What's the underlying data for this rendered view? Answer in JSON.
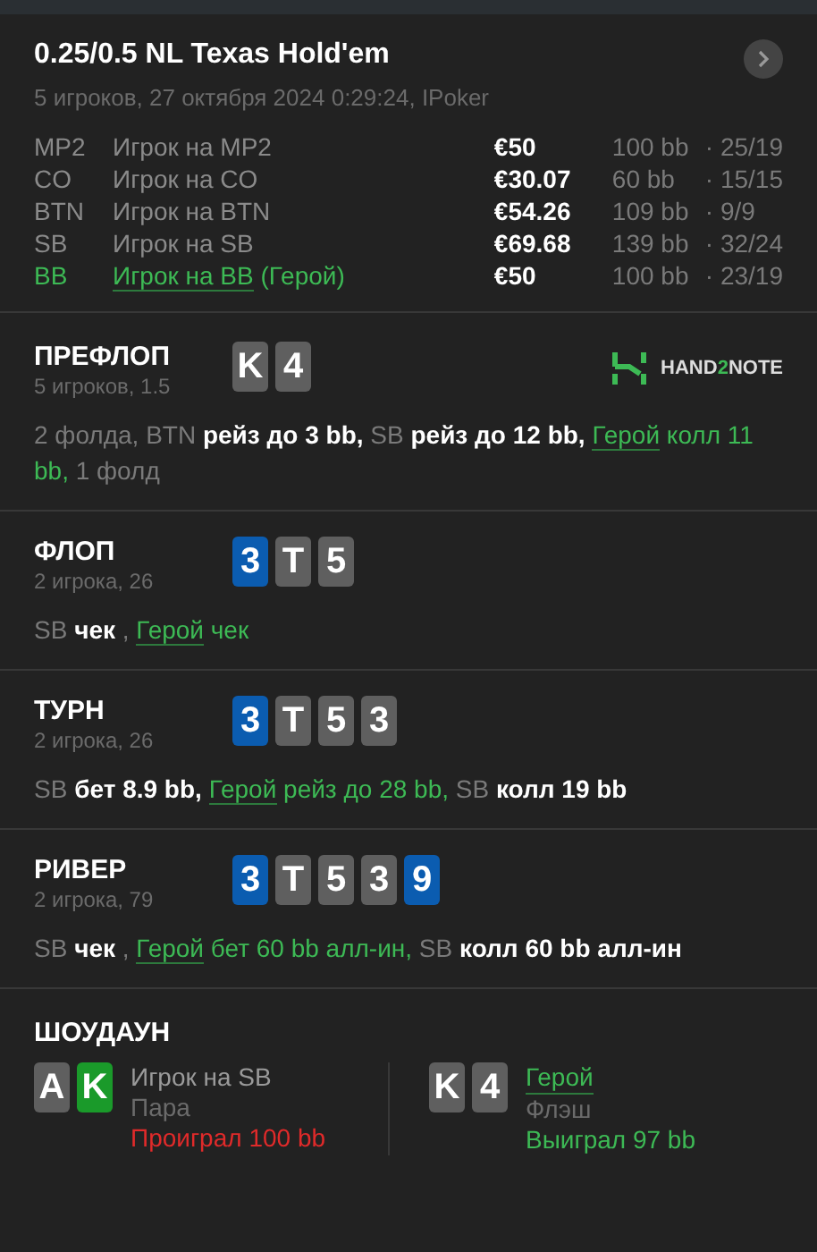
{
  "header": {
    "title": "0.25/0.5 NL Texas Hold'em",
    "subtitle": "5 игроков, 27 октября 2024 0:29:24, IPoker"
  },
  "players": [
    {
      "position": "MP2",
      "name": "Игрок на MP2",
      "hero": false,
      "stack": "€50",
      "bb": "100 bb",
      "stats": "· 25/19"
    },
    {
      "position": "CO",
      "name": "Игрок на CO",
      "hero": false,
      "stack": "€30.07",
      "bb": "60 bb",
      "stats": "· 15/15"
    },
    {
      "position": "BTN",
      "name": "Игрок на BTN",
      "hero": false,
      "stack": "€54.26",
      "bb": "109 bb",
      "stats": "· 9/9"
    },
    {
      "position": "SB",
      "name": "Игрок на SB",
      "hero": false,
      "stack": "€69.68",
      "bb": "139 bb",
      "stats": "· 32/24"
    },
    {
      "position": "BB",
      "name": "Игрок на BB",
      "hero": true,
      "hero_tag": "(Герой)",
      "stack": "€50",
      "bb": "100 bb",
      "stats": "· 23/19"
    }
  ],
  "logo": {
    "before": "HAND",
    "accent": "2",
    "after": "NOTE"
  },
  "streets": [
    {
      "title": "ПРЕФЛОП",
      "info": "5 игроков, 1.5",
      "cards": [
        {
          "rank": "K",
          "color": "#5f5f5f"
        },
        {
          "rank": "4",
          "color": "#5f5f5f"
        }
      ],
      "actions": [
        {
          "kind": "muted",
          "text": "2 фолда, BTN"
        },
        {
          "kind": "action",
          "text": " рейз до 3 bb,"
        },
        {
          "kind": "muted",
          "text": " SB"
        },
        {
          "kind": "action",
          "text": " рейз до 12 bb,"
        },
        {
          "kind": "hero",
          "text": " Герой"
        },
        {
          "kind": "hero_action",
          "text": " колл 11 bb,"
        },
        {
          "kind": "muted",
          "text": " 1 фолд"
        }
      ]
    },
    {
      "title": "ФЛОП",
      "info": "2 игрока, 26",
      "cards": [
        {
          "rank": "3",
          "color": "#0b5cb0"
        },
        {
          "rank": "T",
          "color": "#5f5f5f"
        },
        {
          "rank": "5",
          "color": "#5f5f5f"
        }
      ],
      "actions": [
        {
          "kind": "muted",
          "text": "SB"
        },
        {
          "kind": "action",
          "text": " чек"
        },
        {
          "kind": "muted",
          "text": " ,"
        },
        {
          "kind": "hero",
          "text": " Герой"
        },
        {
          "kind": "hero_action",
          "text": " чек"
        }
      ]
    },
    {
      "title": "ТУРН",
      "info": "2 игрока, 26",
      "cards": [
        {
          "rank": "3",
          "color": "#0b5cb0"
        },
        {
          "rank": "T",
          "color": "#5f5f5f"
        },
        {
          "rank": "5",
          "color": "#5f5f5f"
        },
        {
          "rank": "3",
          "color": "#5f5f5f"
        }
      ],
      "actions": [
        {
          "kind": "muted",
          "text": "SB"
        },
        {
          "kind": "action",
          "text": " бет 8.9 bb,"
        },
        {
          "kind": "hero",
          "text": " Герой"
        },
        {
          "kind": "hero_action",
          "text": " рейз до 28 bb,"
        },
        {
          "kind": "muted",
          "text": " SB"
        },
        {
          "kind": "action",
          "text": " колл 19 bb"
        }
      ]
    },
    {
      "title": "РИВЕР",
      "info": "2 игрока, 79",
      "cards": [
        {
          "rank": "3",
          "color": "#0b5cb0"
        },
        {
          "rank": "T",
          "color": "#5f5f5f"
        },
        {
          "rank": "5",
          "color": "#5f5f5f"
        },
        {
          "rank": "3",
          "color": "#5f5f5f"
        },
        {
          "rank": "9",
          "color": "#0b5cb0"
        }
      ],
      "actions": [
        {
          "kind": "muted",
          "text": "SB"
        },
        {
          "kind": "action",
          "text": " чек"
        },
        {
          "kind": "muted",
          "text": " ,"
        },
        {
          "kind": "hero",
          "text": " Герой"
        },
        {
          "kind": "hero_action",
          "text": " бет 60 bb алл-ин,"
        },
        {
          "kind": "muted",
          "text": " SB"
        },
        {
          "kind": "action",
          "text": " колл 60 bb алл-ин"
        }
      ]
    }
  ],
  "showdown": {
    "title": "ШОУДАУН",
    "hands": [
      {
        "cards": [
          {
            "rank": "A",
            "color": "#5f5f5f"
          },
          {
            "rank": "K",
            "color": "#1a9a2a"
          }
        ],
        "name": "Игрок на SB",
        "hero": false,
        "combo": "Пара",
        "result": "Проиграл 100 bb",
        "won": false
      },
      {
        "cards": [
          {
            "rank": "K",
            "color": "#5f5f5f"
          },
          {
            "rank": "4",
            "color": "#5f5f5f"
          }
        ],
        "name": "Герой",
        "hero": true,
        "combo": "Флэш",
        "result": "Выиграл 97 bb",
        "won": true
      }
    ]
  }
}
